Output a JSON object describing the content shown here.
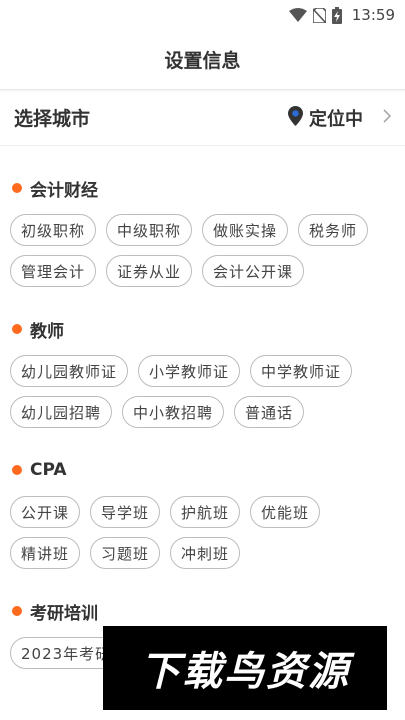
{
  "status_bar": {
    "time": "13:59",
    "icons": [
      "wifi-icon",
      "no-sim-icon",
      "battery-charging-icon"
    ]
  },
  "header": {
    "title": "设置信息"
  },
  "city": {
    "label": "选择城市",
    "location_status": "定位中",
    "icons": [
      "location-pin-icon",
      "chevron-right-icon"
    ],
    "pin_color": "#2b6cd6"
  },
  "accent_color": "#ff6a1f",
  "sections": [
    {
      "title": "会计财经",
      "tags": [
        "初级职称",
        "中级职称",
        "做账实操",
        "税务师",
        "管理会计",
        "证券从业",
        "会计公开课"
      ]
    },
    {
      "title": "教师",
      "tags": [
        "幼儿园教师证",
        "小学教师证",
        "中学教师证",
        "幼儿园招聘",
        "中小教招聘",
        "普通话"
      ]
    },
    {
      "title": "CPA",
      "tags": [
        "公开课",
        "导学班",
        "护航班",
        "优能班",
        "精讲班",
        "习题班",
        "冲刺班"
      ]
    },
    {
      "title": "考研培训",
      "tags": [
        "2023年考研",
        "",
        ""
      ]
    }
  ],
  "watermark": {
    "text": "下载鸟资源"
  }
}
